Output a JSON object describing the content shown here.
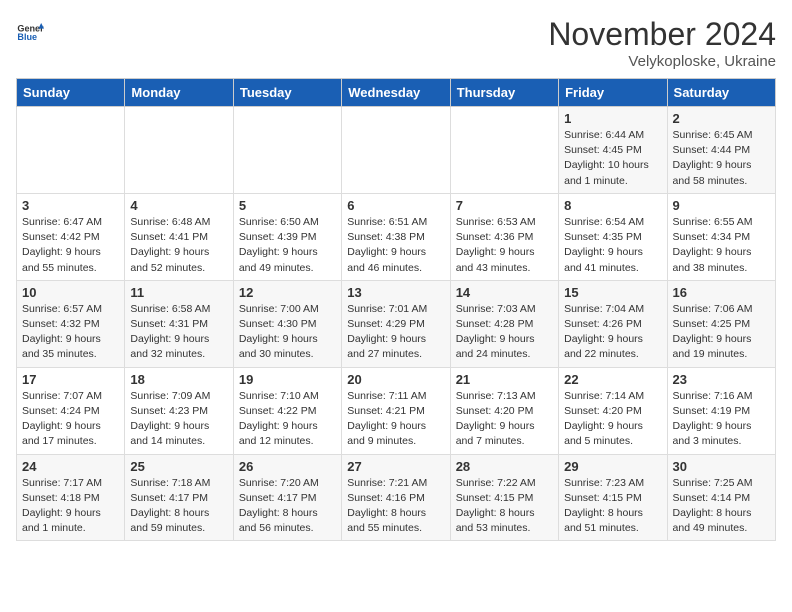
{
  "header": {
    "logo_general": "General",
    "logo_blue": "Blue",
    "month_title": "November 2024",
    "location": "Velykoploske, Ukraine"
  },
  "weekdays": [
    "Sunday",
    "Monday",
    "Tuesday",
    "Wednesday",
    "Thursday",
    "Friday",
    "Saturday"
  ],
  "weeks": [
    [
      {
        "day": "",
        "info": ""
      },
      {
        "day": "",
        "info": ""
      },
      {
        "day": "",
        "info": ""
      },
      {
        "day": "",
        "info": ""
      },
      {
        "day": "",
        "info": ""
      },
      {
        "day": "1",
        "info": "Sunrise: 6:44 AM\nSunset: 4:45 PM\nDaylight: 10 hours\nand 1 minute."
      },
      {
        "day": "2",
        "info": "Sunrise: 6:45 AM\nSunset: 4:44 PM\nDaylight: 9 hours\nand 58 minutes."
      }
    ],
    [
      {
        "day": "3",
        "info": "Sunrise: 6:47 AM\nSunset: 4:42 PM\nDaylight: 9 hours\nand 55 minutes."
      },
      {
        "day": "4",
        "info": "Sunrise: 6:48 AM\nSunset: 4:41 PM\nDaylight: 9 hours\nand 52 minutes."
      },
      {
        "day": "5",
        "info": "Sunrise: 6:50 AM\nSunset: 4:39 PM\nDaylight: 9 hours\nand 49 minutes."
      },
      {
        "day": "6",
        "info": "Sunrise: 6:51 AM\nSunset: 4:38 PM\nDaylight: 9 hours\nand 46 minutes."
      },
      {
        "day": "7",
        "info": "Sunrise: 6:53 AM\nSunset: 4:36 PM\nDaylight: 9 hours\nand 43 minutes."
      },
      {
        "day": "8",
        "info": "Sunrise: 6:54 AM\nSunset: 4:35 PM\nDaylight: 9 hours\nand 41 minutes."
      },
      {
        "day": "9",
        "info": "Sunrise: 6:55 AM\nSunset: 4:34 PM\nDaylight: 9 hours\nand 38 minutes."
      }
    ],
    [
      {
        "day": "10",
        "info": "Sunrise: 6:57 AM\nSunset: 4:32 PM\nDaylight: 9 hours\nand 35 minutes."
      },
      {
        "day": "11",
        "info": "Sunrise: 6:58 AM\nSunset: 4:31 PM\nDaylight: 9 hours\nand 32 minutes."
      },
      {
        "day": "12",
        "info": "Sunrise: 7:00 AM\nSunset: 4:30 PM\nDaylight: 9 hours\nand 30 minutes."
      },
      {
        "day": "13",
        "info": "Sunrise: 7:01 AM\nSunset: 4:29 PM\nDaylight: 9 hours\nand 27 minutes."
      },
      {
        "day": "14",
        "info": "Sunrise: 7:03 AM\nSunset: 4:28 PM\nDaylight: 9 hours\nand 24 minutes."
      },
      {
        "day": "15",
        "info": "Sunrise: 7:04 AM\nSunset: 4:26 PM\nDaylight: 9 hours\nand 22 minutes."
      },
      {
        "day": "16",
        "info": "Sunrise: 7:06 AM\nSunset: 4:25 PM\nDaylight: 9 hours\nand 19 minutes."
      }
    ],
    [
      {
        "day": "17",
        "info": "Sunrise: 7:07 AM\nSunset: 4:24 PM\nDaylight: 9 hours\nand 17 minutes."
      },
      {
        "day": "18",
        "info": "Sunrise: 7:09 AM\nSunset: 4:23 PM\nDaylight: 9 hours\nand 14 minutes."
      },
      {
        "day": "19",
        "info": "Sunrise: 7:10 AM\nSunset: 4:22 PM\nDaylight: 9 hours\nand 12 minutes."
      },
      {
        "day": "20",
        "info": "Sunrise: 7:11 AM\nSunset: 4:21 PM\nDaylight: 9 hours\nand 9 minutes."
      },
      {
        "day": "21",
        "info": "Sunrise: 7:13 AM\nSunset: 4:20 PM\nDaylight: 9 hours\nand 7 minutes."
      },
      {
        "day": "22",
        "info": "Sunrise: 7:14 AM\nSunset: 4:20 PM\nDaylight: 9 hours\nand 5 minutes."
      },
      {
        "day": "23",
        "info": "Sunrise: 7:16 AM\nSunset: 4:19 PM\nDaylight: 9 hours\nand 3 minutes."
      }
    ],
    [
      {
        "day": "24",
        "info": "Sunrise: 7:17 AM\nSunset: 4:18 PM\nDaylight: 9 hours\nand 1 minute."
      },
      {
        "day": "25",
        "info": "Sunrise: 7:18 AM\nSunset: 4:17 PM\nDaylight: 8 hours\nand 59 minutes."
      },
      {
        "day": "26",
        "info": "Sunrise: 7:20 AM\nSunset: 4:17 PM\nDaylight: 8 hours\nand 56 minutes."
      },
      {
        "day": "27",
        "info": "Sunrise: 7:21 AM\nSunset: 4:16 PM\nDaylight: 8 hours\nand 55 minutes."
      },
      {
        "day": "28",
        "info": "Sunrise: 7:22 AM\nSunset: 4:15 PM\nDaylight: 8 hours\nand 53 minutes."
      },
      {
        "day": "29",
        "info": "Sunrise: 7:23 AM\nSunset: 4:15 PM\nDaylight: 8 hours\nand 51 minutes."
      },
      {
        "day": "30",
        "info": "Sunrise: 7:25 AM\nSunset: 4:14 PM\nDaylight: 8 hours\nand 49 minutes."
      }
    ]
  ]
}
